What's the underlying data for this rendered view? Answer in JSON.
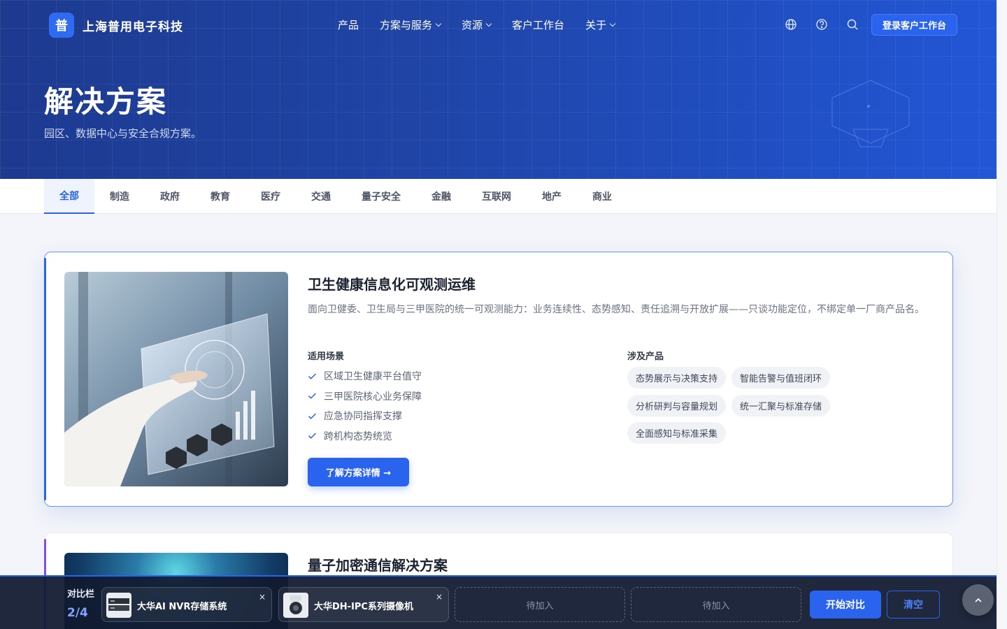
{
  "brand": {
    "logo_char": "普",
    "name": "上海普用电子科技"
  },
  "nav": {
    "items": [
      {
        "label": "产品",
        "dropdown": false
      },
      {
        "label": "方案与服务",
        "dropdown": true
      },
      {
        "label": "资源",
        "dropdown": true
      },
      {
        "label": "客户工作台",
        "dropdown": false
      },
      {
        "label": "关于",
        "dropdown": true
      }
    ],
    "icons": [
      "globe-icon",
      "help-icon",
      "search-icon"
    ],
    "login_label": "登录客户工作台"
  },
  "hero": {
    "title": "解决方案",
    "subtitle": "园区、数据中心与安全合规方案。"
  },
  "tabs": [
    {
      "label": "全部",
      "active": true
    },
    {
      "label": "制造"
    },
    {
      "label": "政府"
    },
    {
      "label": "教育"
    },
    {
      "label": "医疗"
    },
    {
      "label": "交通"
    },
    {
      "label": "量子安全"
    },
    {
      "label": "金融"
    },
    {
      "label": "互联网"
    },
    {
      "label": "地产"
    },
    {
      "label": "商业"
    }
  ],
  "solutions": [
    {
      "title": "卫生健康信息化可观测运维",
      "description": "面向卫健委、卫生局与三甲医院的统一可观测能力：业务连续性、态势感知、责任追溯与开放扩展——只谈功能定位，不绑定单一厂商产品名。",
      "scenarios_label": "适用场景",
      "scenarios": [
        "区域卫生健康平台值守",
        "三甲医院核心业务保障",
        "应急协同指挥支撑",
        "跨机构态势统览"
      ],
      "products_label": "涉及产品",
      "products": [
        "态势展示与决策支持",
        "智能告警与值班闭环",
        "分析研判与容量规划",
        "统一汇聚与标准存储",
        "全面感知与标准采集"
      ],
      "cta_label": "了解方案详情 →",
      "accent": "#2a63ee"
    },
    {
      "title": "量子加密通信解决方案",
      "description": "",
      "accent": "#7d52e8"
    }
  ],
  "compare_bar": {
    "label": "对比栏",
    "count": "2/4",
    "slots": [
      {
        "name": "大华AI NVR存储系统",
        "filled": true,
        "remove": "×"
      },
      {
        "name": "大华DH-IPC系列摄像机",
        "filled": true,
        "remove": "×"
      },
      {
        "name": "待加入",
        "filled": false
      },
      {
        "name": "待加入",
        "filled": false
      }
    ],
    "start_label": "开始对比",
    "clear_label": "清空"
  },
  "colors": {
    "primary": "#2a63ee",
    "hero_start": "#1d3a8f",
    "hero_end": "#2256d6",
    "compare_bg": "#111b30"
  }
}
